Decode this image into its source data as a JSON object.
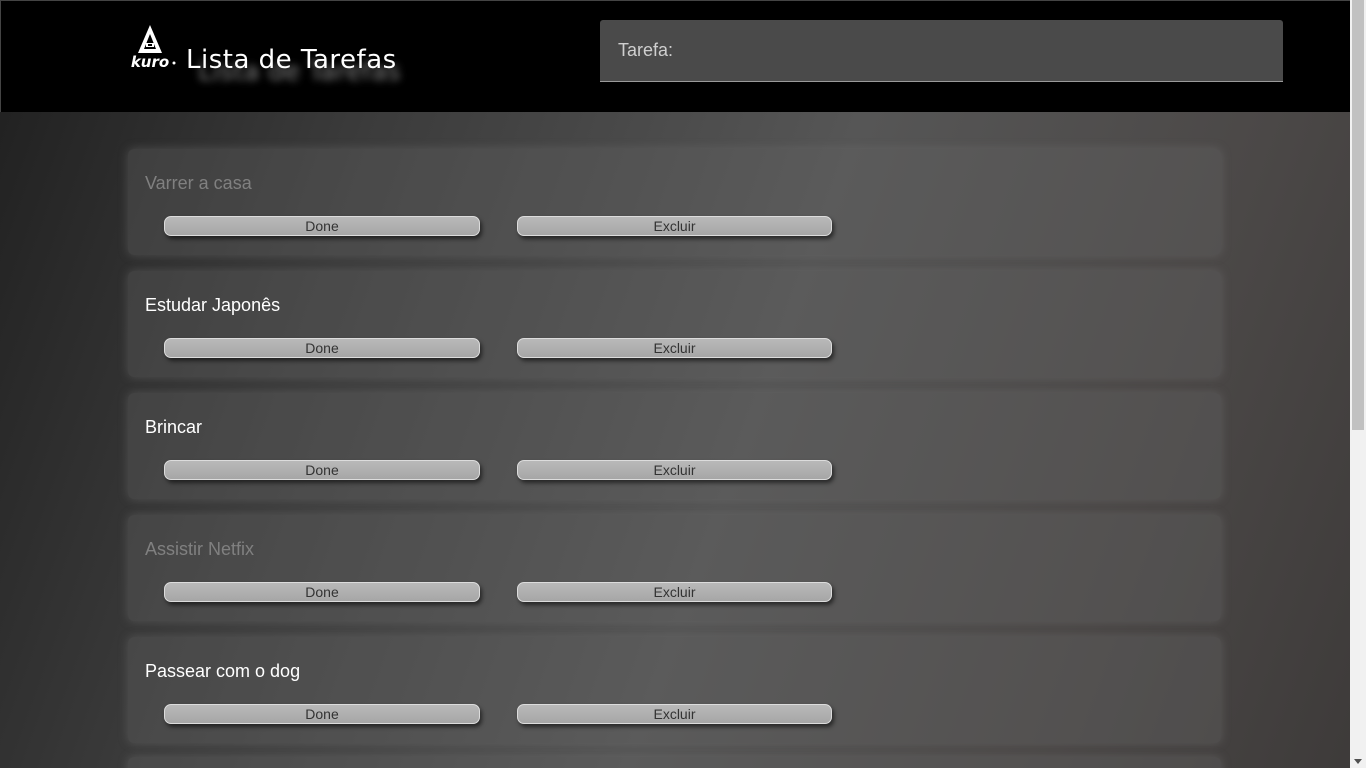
{
  "header": {
    "logo_text": "kuro",
    "title": "Lista de Tarefas"
  },
  "input": {
    "placeholder": "Tarefa:",
    "value": ""
  },
  "tasks": [
    {
      "title": "Varrer a casa",
      "done": true,
      "done_label": "Done",
      "delete_label": "Excluir"
    },
    {
      "title": "Estudar Japonês",
      "done": false,
      "done_label": "Done",
      "delete_label": "Excluir"
    },
    {
      "title": "Brincar",
      "done": false,
      "done_label": "Done",
      "delete_label": "Excluir"
    },
    {
      "title": "Assistir Netfix",
      "done": true,
      "done_label": "Done",
      "delete_label": "Excluir"
    },
    {
      "title": "Passear com o dog",
      "done": false,
      "done_label": "Done",
      "delete_label": "Excluir"
    }
  ],
  "colors": {
    "header_bg": "#000000",
    "done_text": "#808080",
    "active_text": "#ffffff"
  }
}
